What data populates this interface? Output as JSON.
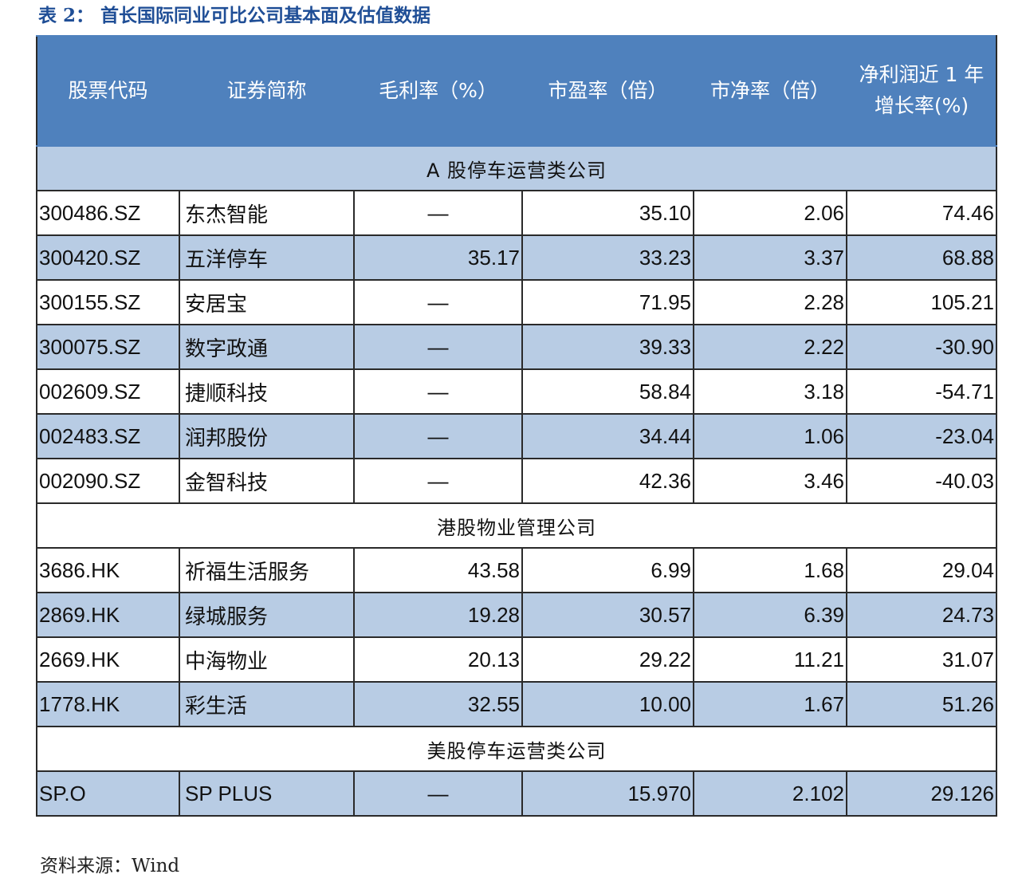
{
  "caption": "表 2： 首长国际同业可比公司基本面及估值数据",
  "headers": {
    "code": "股票代码",
    "name": "证券简称",
    "gross_margin": "毛利率（%）",
    "pe": "市盈率（倍）",
    "pb": "市净率（倍）",
    "growth_line1": "净利润近 1 年",
    "growth_line2": "增长率(%)"
  },
  "sections": [
    {
      "title": "A 股停车运营类公司",
      "rows": [
        {
          "code": "300486.SZ",
          "name": "东杰智能",
          "gm": "—",
          "pe": "35.10",
          "pb": "2.06",
          "growth": "74.46"
        },
        {
          "code": "300420.SZ",
          "name": "五洋停车",
          "gm": "35.17",
          "pe": "33.23",
          "pb": "3.37",
          "growth": "68.88"
        },
        {
          "code": "300155.SZ",
          "name": "安居宝",
          "gm": "—",
          "pe": "71.95",
          "pb": "2.28",
          "growth": "105.21"
        },
        {
          "code": "300075.SZ",
          "name": "数字政通",
          "gm": "—",
          "pe": "39.33",
          "pb": "2.22",
          "growth": "-30.90"
        },
        {
          "code": "002609.SZ",
          "name": "捷顺科技",
          "gm": "—",
          "pe": "58.84",
          "pb": "3.18",
          "growth": "-54.71"
        },
        {
          "code": "002483.SZ",
          "name": "润邦股份",
          "gm": "—",
          "pe": "34.44",
          "pb": "1.06",
          "growth": "-23.04"
        },
        {
          "code": "002090.SZ",
          "name": "金智科技",
          "gm": "—",
          "pe": "42.36",
          "pb": "3.46",
          "growth": "-40.03"
        }
      ]
    },
    {
      "title": "港股物业管理公司",
      "rows": [
        {
          "code": "3686.HK",
          "name": "祈福生活服务",
          "gm": "43.58",
          "pe": "6.99",
          "pb": "1.68",
          "growth": "29.04"
        },
        {
          "code": "2869.HK",
          "name": "绿城服务",
          "gm": "19.28",
          "pe": "30.57",
          "pb": "6.39",
          "growth": "24.73"
        },
        {
          "code": "2669.HK",
          "name": "中海物业",
          "gm": "20.13",
          "pe": "29.22",
          "pb": "11.21",
          "growth": "31.07"
        },
        {
          "code": "1778.HK",
          "name": "彩生活",
          "gm": "32.55",
          "pe": "10.00",
          "pb": "1.67",
          "growth": "51.26"
        }
      ]
    },
    {
      "title": "美股停车运营类公司",
      "rows": [
        {
          "code": "SP.O",
          "name": "SP PLUS",
          "gm": "—",
          "pe": "15.970",
          "pb": "2.102",
          "growth": "29.126"
        }
      ]
    }
  ],
  "source": "资料来源：Wind",
  "colors": {
    "header_bg": "#4f81bd",
    "shade": "#b8cce4",
    "caption": "#1f4e96"
  }
}
